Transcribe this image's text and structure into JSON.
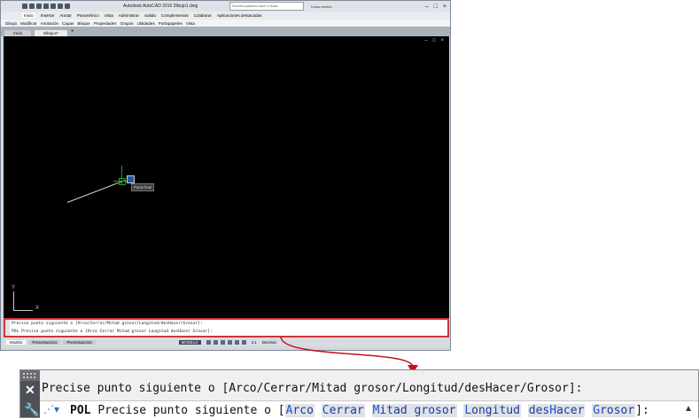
{
  "app": {
    "title": "Autodesk AutoCAD 2016   Dibujo1.dwg",
    "search_placeholder": "Escriba palabra clave o frase",
    "signin_label": "Iniciar sesión",
    "logo_letter": "A",
    "window_buttons": [
      "–",
      "□",
      "×"
    ]
  },
  "menu_tabs": [
    "Inicio",
    "Insertar",
    "Anotar",
    "Paramétrico",
    "Vista",
    "Administrar",
    "Salida",
    "Complementos",
    "Colaborar",
    "Aplicaciones destacadas"
  ],
  "ribbon_panels": [
    "Dibujo",
    "Modificar",
    "Anotación",
    "Capas",
    "Bloque",
    "Propiedades",
    "Grupos",
    "Utilidades",
    "Portapapeles",
    "Vista"
  ],
  "file_tabs": [
    {
      "label": "Inicio"
    },
    {
      "label": "Dibujo1*"
    }
  ],
  "new_tab_label": "+",
  "view_controls": "– □ ×",
  "ucs": {
    "x_label": "X",
    "y_label": "Y"
  },
  "cursor_tooltip": "Punto final",
  "command_small": {
    "history": "Precise punto siguiente o [Arco/Cerrar/Mitad grosor/Longitud/desHacer/Grosor]:",
    "prompt": "POL Precise punto siguiente o [Arco Cerrar Mitad grosor Longitud desHacer Grosor]:"
  },
  "status_bar": {
    "layout_tabs": [
      "Modelo",
      "Presentación1",
      "Presentación2"
    ],
    "model_button": "MODELO",
    "scale": "1:1",
    "units": "Decimal"
  },
  "command_zoom": {
    "history": "Precise punto siguiente o [Arco/Cerrar/Mitad grosor/Longitud/desHacer/Grosor]:",
    "command_name": "POL",
    "prompt_text": "Precise punto siguiente o [",
    "options": [
      {
        "key": "A",
        "rest": "rco"
      },
      {
        "key": "C",
        "rest": "errar"
      },
      {
        "key": "M",
        "rest": "itad grosor"
      },
      {
        "key": "L",
        "rest": "ongitud"
      },
      {
        "key": "H",
        "prefix": "des",
        "rest": "acer"
      },
      {
        "key": "G",
        "rest": "rosor"
      }
    ],
    "prompt_end": "]:",
    "close_icon": "close-icon",
    "customize_icon": "wrench-icon"
  },
  "colors": {
    "highlight": "#d03535",
    "canvas": "#000000",
    "option_key": "#1a52d1"
  }
}
